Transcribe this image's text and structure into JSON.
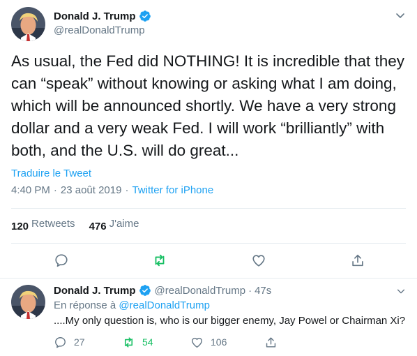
{
  "colors": {
    "accent": "#1da1f2",
    "secondary_text": "#657786",
    "retweet_green": "#17bf63",
    "divider": "#e6ecf0",
    "verified_blue": "#1da1f2"
  },
  "main_tweet": {
    "author": {
      "display_name": "Donald J. Trump",
      "handle": "@realDonaldTrump",
      "verified_icon": "verified-badge-icon"
    },
    "text": "As usual, the Fed did NOTHING! It is incredible that they can “speak” without knowing or asking what I am doing, which will be announced shortly. We have a very strong dollar and a very weak Fed. I will work “brilliantly” with both, and the U.S. will do great...",
    "translate_label": "Traduire le Tweet",
    "time": "4:40 PM",
    "date": "23 août 2019",
    "separator": "·",
    "source": "Twitter for iPhone",
    "stats": {
      "retweets_count": "120",
      "retweets_label": "Retweets",
      "likes_count": "476",
      "likes_label": "J'aime"
    },
    "actions": [
      "reply-icon",
      "retweet-icon",
      "like-icon",
      "share-icon"
    ]
  },
  "reply_tweet": {
    "author": {
      "display_name": "Donald J. Trump",
      "handle": "@realDonaldTrump",
      "separator": "·",
      "time": "47s"
    },
    "reply_prefix": "En réponse à",
    "reply_mention": "@realDonaldTrump",
    "text": "....My only question is, who is our bigger enemy, Jay Powel or Chairman Xi?",
    "replies": "27",
    "retweets": "54",
    "likes": "106"
  }
}
